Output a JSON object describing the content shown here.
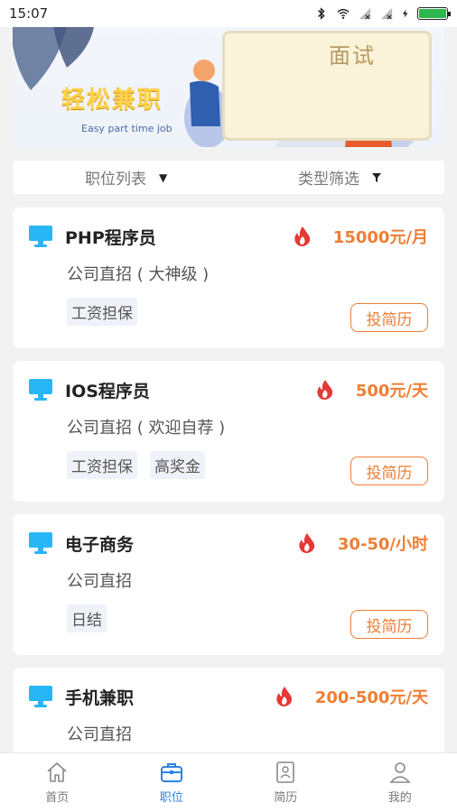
{
  "status_bar": {
    "time": "15:07",
    "icons": [
      "bluetooth-icon",
      "wifi-icon",
      "signal-icon",
      "signal-icon",
      "charging-icon",
      "battery-icon"
    ],
    "battery_color": "#2db84d"
  },
  "banner": {
    "brand_text": "轻松兼职",
    "subtitle": "Easy part time job",
    "board_text": "面试"
  },
  "filter": {
    "left_label": "职位列表",
    "right_label": "类型筛选"
  },
  "jobs": [
    {
      "title": "PHP程序员",
      "salary": "15000元/月",
      "company": "公司直招 ( 大神级 )",
      "tags": [
        "工资担保"
      ],
      "apply_label": "投简历"
    },
    {
      "title": "IOS程序员",
      "salary": "500元/天",
      "company": "公司直招 ( 欢迎自荐 )",
      "tags": [
        "工资担保",
        "高奖金"
      ],
      "apply_label": "投简历"
    },
    {
      "title": "电子商务",
      "salary": "30-50/小时",
      "company": "公司直招",
      "tags": [
        "日结"
      ],
      "apply_label": "投简历"
    },
    {
      "title": "手机兼职",
      "salary": "200-500元/天",
      "company": "公司直招",
      "tags": [],
      "apply_label": ""
    }
  ],
  "bottom_nav": {
    "items": [
      {
        "label": "首页",
        "icon": "home-icon"
      },
      {
        "label": "职位",
        "icon": "briefcase-icon",
        "active": true
      },
      {
        "label": "简历",
        "icon": "resume-icon"
      },
      {
        "label": "我的",
        "icon": "user-icon"
      }
    ]
  },
  "colors": {
    "accent": "#ef7e34",
    "nav_active": "#2d82e6",
    "monitor_icon": "#29b6f6",
    "fire_icon": "#e53935"
  }
}
